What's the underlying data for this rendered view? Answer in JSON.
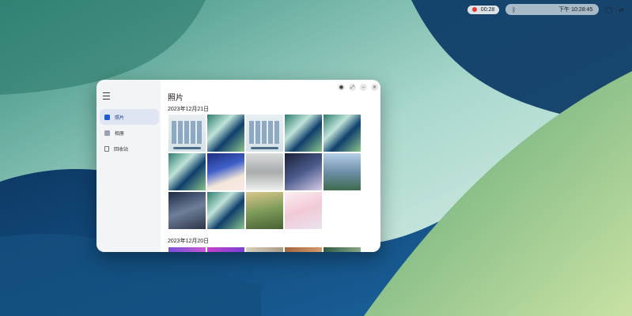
{
  "topbar": {
    "record_time": "00:28",
    "datetime": "下午 10:28:45",
    "icons": [
      "record-dot-icon",
      "bluetooth-icon",
      "network-icon",
      "volume-icon",
      "chat-icon",
      "switch-icon"
    ]
  },
  "window": {
    "sidebar": {
      "items": [
        {
          "label": "照片",
          "icon": "photos-icon",
          "active": true
        },
        {
          "label": "相册",
          "icon": "albums-icon",
          "active": false
        },
        {
          "label": "回收站",
          "icon": "trash-icon",
          "active": false
        }
      ]
    },
    "controls": [
      "record-icon",
      "fullscreen-icon",
      "minimize-icon",
      "close-icon"
    ],
    "title": "照片",
    "groups": [
      {
        "date": "2023年12月21日",
        "count": 13
      },
      {
        "date": "2023年12月20日",
        "count": 5
      }
    ]
  },
  "colors": {
    "accent": "#1f5bd6",
    "sidebar_active_bg": "#dfe5f3",
    "record_dot": "#e53935"
  }
}
